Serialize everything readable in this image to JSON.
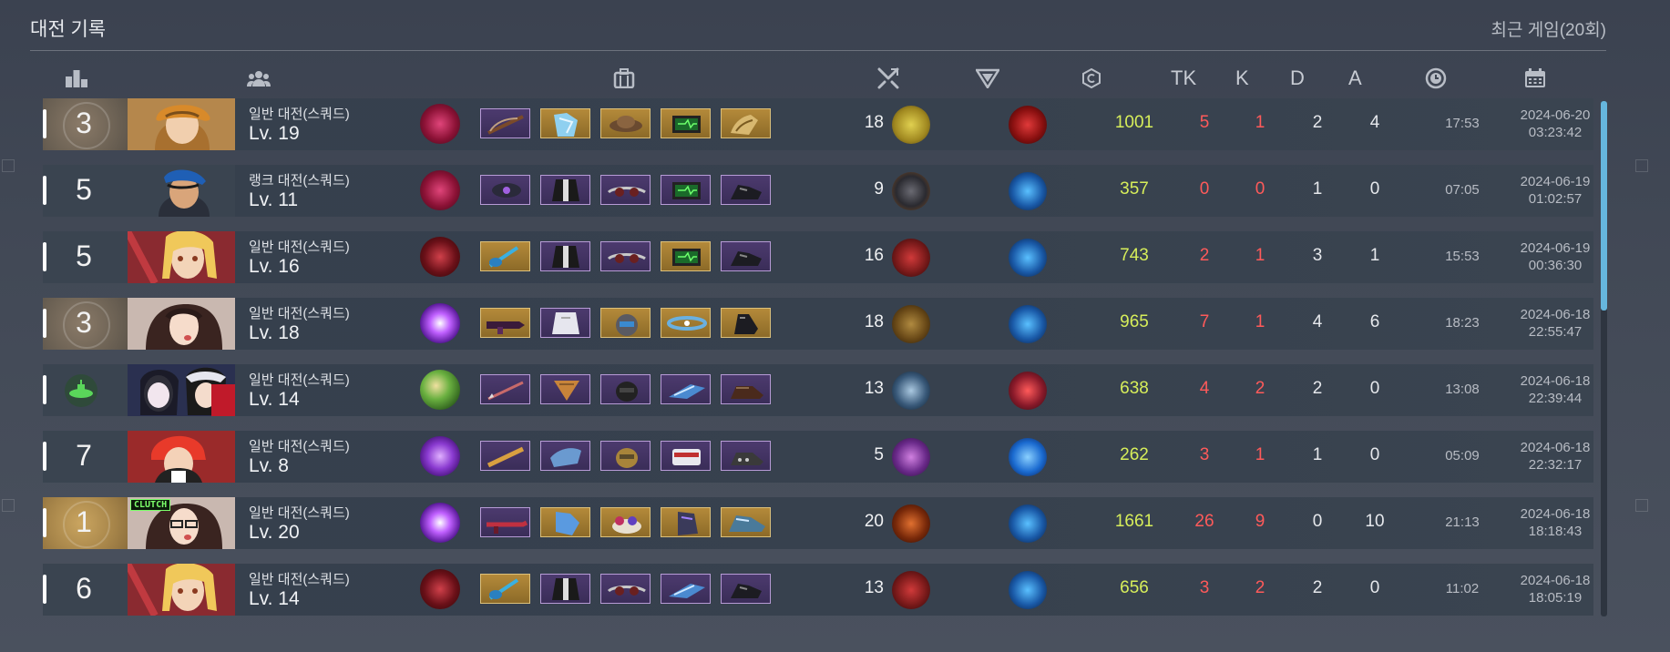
{
  "title": "대전 기록",
  "subtitle": "최근 게임(20회)",
  "header": {
    "rank_icon": "ranking-bars-icon",
    "team_icon": "team-members-icon",
    "items_icon": "backpack-icon",
    "weapon_icon": "crossed-swords-icon",
    "trait_icon": "trait-emblem-icon",
    "credit_icon": "credit-coin-icon",
    "tk": "TK",
    "k": "K",
    "d": "D",
    "a": "A",
    "time_icon": "clock-icon",
    "date_icon": "calendar-icon"
  },
  "colors": {
    "credit": "#d7ee5a",
    "kill": "#ff5a5a",
    "scroll_thumb": "#66b6dd",
    "item_purple": "#4c3a6e",
    "item_gold": "#b48a3a"
  },
  "matches": [
    {
      "rank": "3",
      "mode": "일반 대전(스쿼드)",
      "level": "Lv. 19",
      "weapon_level": "18",
      "credit": "1001",
      "tk": "5",
      "k": "1",
      "d": "2",
      "a": "4",
      "time": "17:53",
      "date": "2024-06-20",
      "clock": "03:23:42"
    },
    {
      "rank": "5",
      "mode": "랭크 대전(스쿼드)",
      "level": "Lv. 11",
      "weapon_level": "9",
      "credit": "357",
      "tk": "0",
      "k": "0",
      "d": "1",
      "a": "0",
      "time": "07:05",
      "date": "2024-06-19",
      "clock": "01:02:57"
    },
    {
      "rank": "5",
      "mode": "일반 대전(스쿼드)",
      "level": "Lv. 16",
      "weapon_level": "16",
      "credit": "743",
      "tk": "2",
      "k": "1",
      "d": "3",
      "a": "1",
      "time": "15:53",
      "date": "2024-06-19",
      "clock": "00:36:30"
    },
    {
      "rank": "3",
      "mode": "일반 대전(스쿼드)",
      "level": "Lv. 18",
      "weapon_level": "18",
      "credit": "965",
      "tk": "7",
      "k": "1",
      "d": "4",
      "a": "6",
      "time": "18:23",
      "date": "2024-06-18",
      "clock": "22:55:47"
    },
    {
      "rank": "",
      "mode": "일반 대전(스쿼드)",
      "level": "Lv. 14",
      "weapon_level": "13",
      "credit": "638",
      "tk": "4",
      "k": "2",
      "d": "2",
      "a": "0",
      "time": "13:08",
      "date": "2024-06-18",
      "clock": "22:39:44"
    },
    {
      "rank": "7",
      "mode": "일반 대전(스쿼드)",
      "level": "Lv. 8",
      "weapon_level": "5",
      "credit": "262",
      "tk": "3",
      "k": "1",
      "d": "1",
      "a": "0",
      "time": "05:09",
      "date": "2024-06-18",
      "clock": "22:32:17"
    },
    {
      "rank": "1",
      "mode": "일반 대전(스쿼드)",
      "level": "Lv. 20",
      "weapon_level": "20",
      "credit": "1661",
      "tk": "26",
      "k": "9",
      "d": "0",
      "a": "10",
      "time": "21:13",
      "date": "2024-06-18",
      "clock": "18:18:43",
      "badge": "CLUTCH"
    },
    {
      "rank": "6",
      "mode": "일반 대전(스쿼드)",
      "level": "Lv. 14",
      "weapon_level": "13",
      "credit": "656",
      "tk": "3",
      "k": "2",
      "d": "2",
      "a": "0",
      "time": "11:02",
      "date": "2024-06-18",
      "clock": "18:05:19"
    }
  ]
}
